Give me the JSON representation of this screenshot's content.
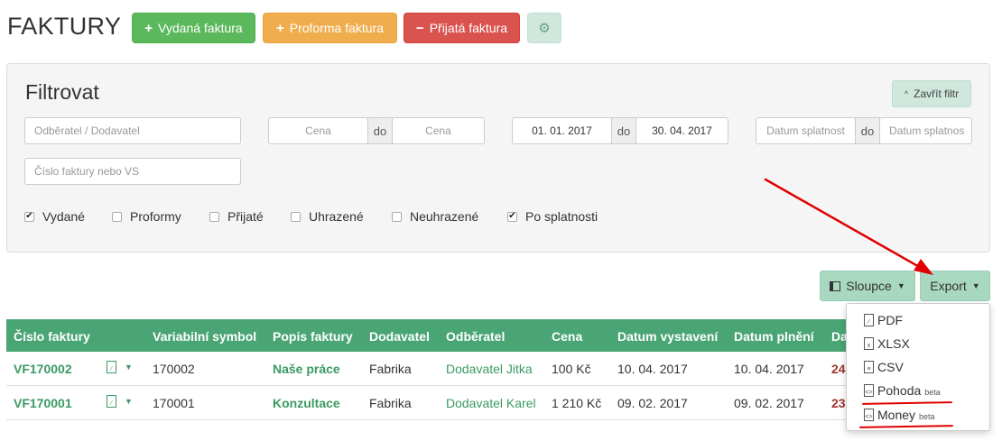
{
  "header": {
    "title": "FAKTURY",
    "btn_issued": "Vydaná faktura",
    "btn_proforma": "Proforma faktura",
    "btn_received": "Přijatá faktura"
  },
  "filter": {
    "title": "Filtrovat",
    "close_label": "Zavřít filtr",
    "customer_placeholder": "Odběratel / Dodavatel",
    "price_from_placeholder": "Cena",
    "price_to_placeholder": "Cena",
    "to_label": "do",
    "date_from": "01. 01. 2017",
    "date_to": "30. 04. 2017",
    "due_from_placeholder": "Datum splatnost",
    "due_to_placeholder": "Datum splatnos",
    "invoice_placeholder": "Číslo faktury nebo VS",
    "checkboxes": [
      {
        "label": "Vydané",
        "checked": true
      },
      {
        "label": "Proformy",
        "checked": false
      },
      {
        "label": "Přijaté",
        "checked": false
      },
      {
        "label": "Uhrazené",
        "checked": false
      },
      {
        "label": "Neuhrazené",
        "checked": false
      },
      {
        "label": "Po splatnosti",
        "checked": true
      }
    ]
  },
  "toolbar": {
    "columns_label": "Sloupce",
    "export_label": "Export"
  },
  "table": {
    "columns": [
      "Číslo faktury",
      "Variabilní symbol",
      "Popis faktury",
      "Dodavatel",
      "Odběratel",
      "Cena",
      "Datum vystavení",
      "Datum plnění",
      "Da"
    ],
    "rows": [
      {
        "number": "VF170002",
        "vs": "170002",
        "desc": "Naše práce",
        "supplier": "Fabrika",
        "customer": "Dodavatel Jitka",
        "price": "100 Kč",
        "issued": "10. 04. 2017",
        "fulfilled": "10. 04. 2017",
        "due": "24."
      },
      {
        "number": "VF170001",
        "vs": "170001",
        "desc": "Konzultace",
        "supplier": "Fabrika",
        "customer": "Dodavatel Karel",
        "price": "1 210 Kč",
        "issued": "09. 02. 2017",
        "fulfilled": "09. 02. 2017",
        "due": "23."
      }
    ]
  },
  "export_menu": {
    "items": [
      {
        "label": "PDF",
        "beta": ""
      },
      {
        "label": "XLSX",
        "beta": ""
      },
      {
        "label": "CSV",
        "beta": ""
      },
      {
        "label": "Pohoda",
        "beta": "beta"
      },
      {
        "label": "Money",
        "beta": "beta"
      }
    ]
  },
  "colors": {
    "accent_green": "#4aa574",
    "annotation_red": "#e00000"
  }
}
